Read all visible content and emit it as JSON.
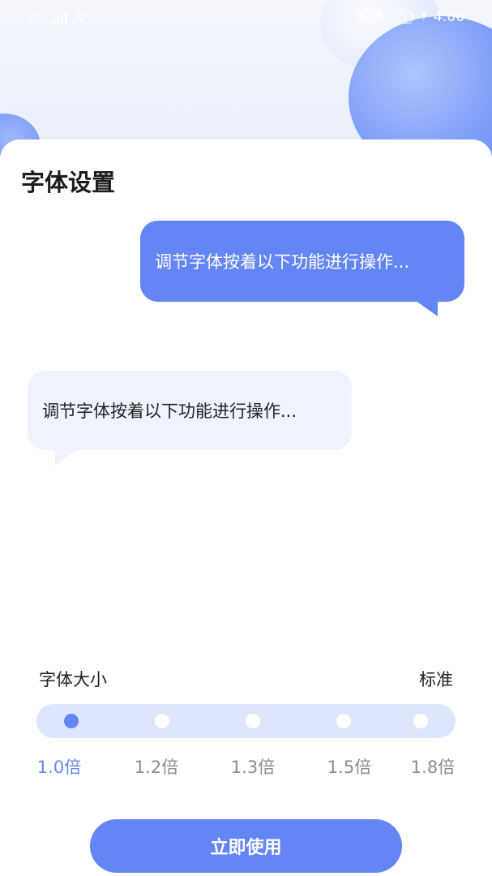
{
  "status_bar": {
    "left_badge": "HD",
    "battery": "71",
    "time": "4:06"
  },
  "page": {
    "title": "字体设置"
  },
  "preview": {
    "sent_message": "调节字体按着以下功能进行操作...",
    "received_message": "调节字体按着以下功能进行操作..."
  },
  "font_size": {
    "label": "字体大小",
    "current_value": "标准",
    "options": [
      "1.0倍",
      "1.2倍",
      "1.3倍",
      "1.5倍",
      "1.8倍"
    ],
    "selected_index": 0
  },
  "actions": {
    "apply_label": "立即使用"
  },
  "colors": {
    "accent": "#6486f5",
    "track": "#dde7fb",
    "bubble_light": "#eef3fd"
  },
  "icons": {
    "status_left": [
      "hd-icon",
      "signal-icon",
      "wifi-icon"
    ],
    "status_right": [
      "bluetooth-icon",
      "mute-bell-icon",
      "battery-icon",
      "charging-icon"
    ]
  }
}
